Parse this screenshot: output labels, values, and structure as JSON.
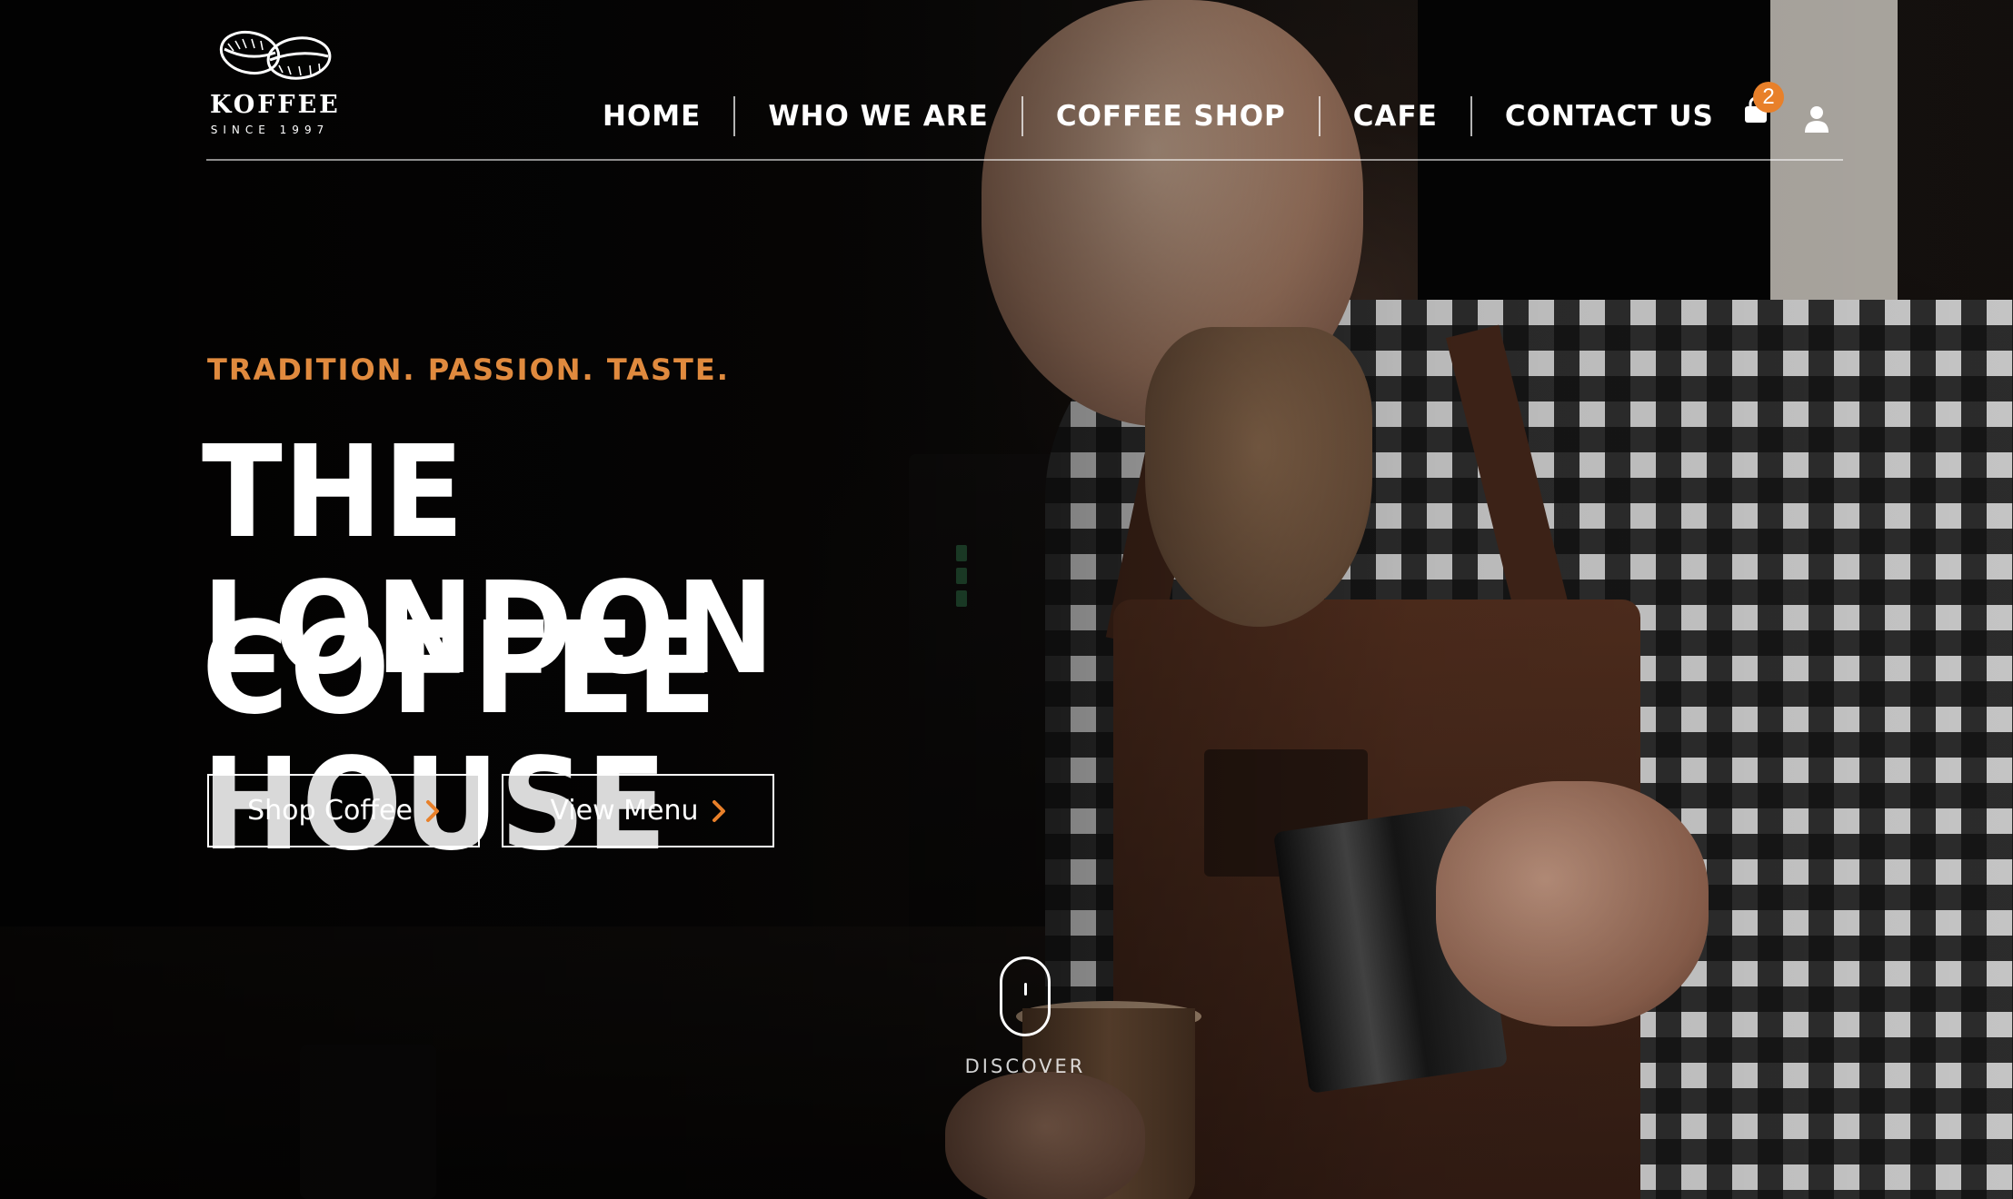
{
  "brand": {
    "name": "KOFFEE",
    "since": "SINCE 1997"
  },
  "nav": {
    "items": [
      {
        "label": "HOME"
      },
      {
        "label": "WHO WE ARE"
      },
      {
        "label": "COFFEE SHOP"
      },
      {
        "label": "CAFE"
      },
      {
        "label": "CONTACT US"
      }
    ],
    "cart_count": "2",
    "icons": [
      "shopping-bag-icon",
      "user-icon"
    ]
  },
  "hero": {
    "tagline": "TRADITION. PASSION. TASTE.",
    "headline_line1": "THE LONDON",
    "headline_line2": "COFFEE HOUSE",
    "buttons": {
      "shop": "Shop Coffee",
      "menu": "View Menu"
    },
    "scroll_label": "DISCOVER"
  },
  "colors": {
    "accent": "#e8802a",
    "tagline": "#e08a3e",
    "text": "#ffffff",
    "background": "#0b0908"
  }
}
